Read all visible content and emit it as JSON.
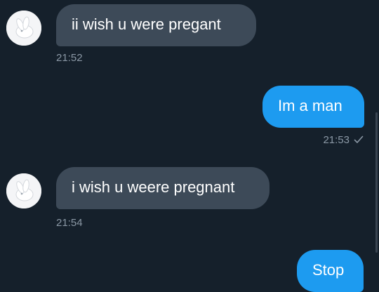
{
  "messages": [
    {
      "direction": "incoming",
      "text": "ii wish u were  pregant",
      "time": "21:52",
      "avatar_icon": "white-rabbit-avatar-icon"
    },
    {
      "direction": "outgoing",
      "text": "Im a man",
      "time": "21:53",
      "status_icon": "checkmark-icon"
    },
    {
      "direction": "incoming",
      "text": "i wish u weere pregnant",
      "time": "21:54",
      "avatar_icon": "white-rabbit-avatar-icon"
    },
    {
      "direction": "outgoing",
      "text": "Stop"
    }
  ],
  "colors": {
    "background": "#15202b",
    "incoming_bubble": "#3d4a58",
    "outgoing_bubble": "#1d9bf0",
    "timestamp": "#8b98a5"
  }
}
